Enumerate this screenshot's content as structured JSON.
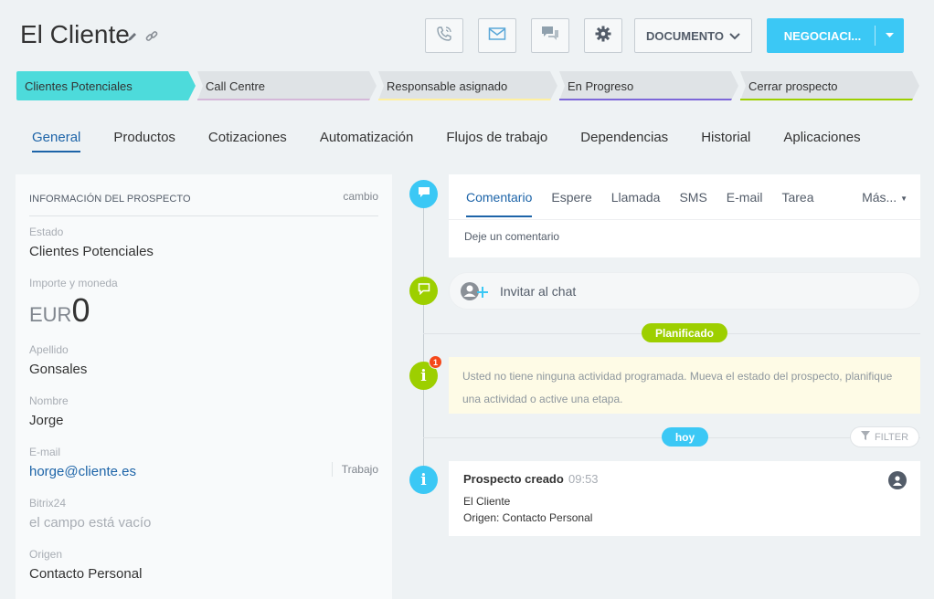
{
  "header": {
    "title": "El Cliente",
    "document_label": "DOCUMENTO",
    "negotiate_label": "NEGOCIACI..."
  },
  "stages": [
    {
      "label": "Clientes Potenciales",
      "color": "#4ddbdb"
    },
    {
      "label": "Call Centre",
      "color": "#d5b8d9"
    },
    {
      "label": "Responsable asignado",
      "color": "#fff0a0"
    },
    {
      "label": "En Progreso",
      "color": "#7d67d9"
    },
    {
      "label": "Cerrar prospecto",
      "color": "#9dcf00"
    }
  ],
  "tabs": [
    "General",
    "Productos",
    "Cotizaciones",
    "Automatización",
    "Flujos de trabajo",
    "Dependencias",
    "Historial",
    "Aplicaciones"
  ],
  "lead_info": {
    "section_title": "INFORMACIÓN DEL PROSPECTO",
    "change_label": "cambio",
    "status_label": "Estado",
    "status_value": "Clientes Potenciales",
    "amount_label": "Importe y moneda",
    "currency": "EUR",
    "amount": "0",
    "lastname_label": "Apellido",
    "lastname_value": "Gonsales",
    "name_label": "Nombre",
    "name_value": "Jorge",
    "email_label": "E-mail",
    "email_value": "horge@cliente.es",
    "email_type": "Trabajo",
    "bitrix_label": "Bitrix24",
    "bitrix_value": "el campo está vacío",
    "origin_label": "Origen",
    "origin_value": "Contacto Personal"
  },
  "timeline": {
    "comment_tabs": [
      "Comentario",
      "Espere",
      "Llamada",
      "SMS",
      "E-mail",
      "Tarea"
    ],
    "more_label": "Más...",
    "comment_placeholder": "Deje un comentario",
    "invite_chat": "Invitar al chat",
    "planned_label": "Planificado",
    "no_activity_text": "Usted no tiene ninguna actividad programada. Mueva el estado del prospecto, planifique una actividad o active una etapa.",
    "badge_count": "1",
    "today_label": "hoy",
    "filter_label": "FILTER",
    "event_title": "Prospecto creado",
    "event_time": "09:53",
    "event_line1": "El Cliente",
    "event_line2": "Origen: Contacto Personal"
  },
  "colors": {
    "accent": "#3bc8f5",
    "link": "#1d64a8",
    "green": "#9dcf00"
  }
}
